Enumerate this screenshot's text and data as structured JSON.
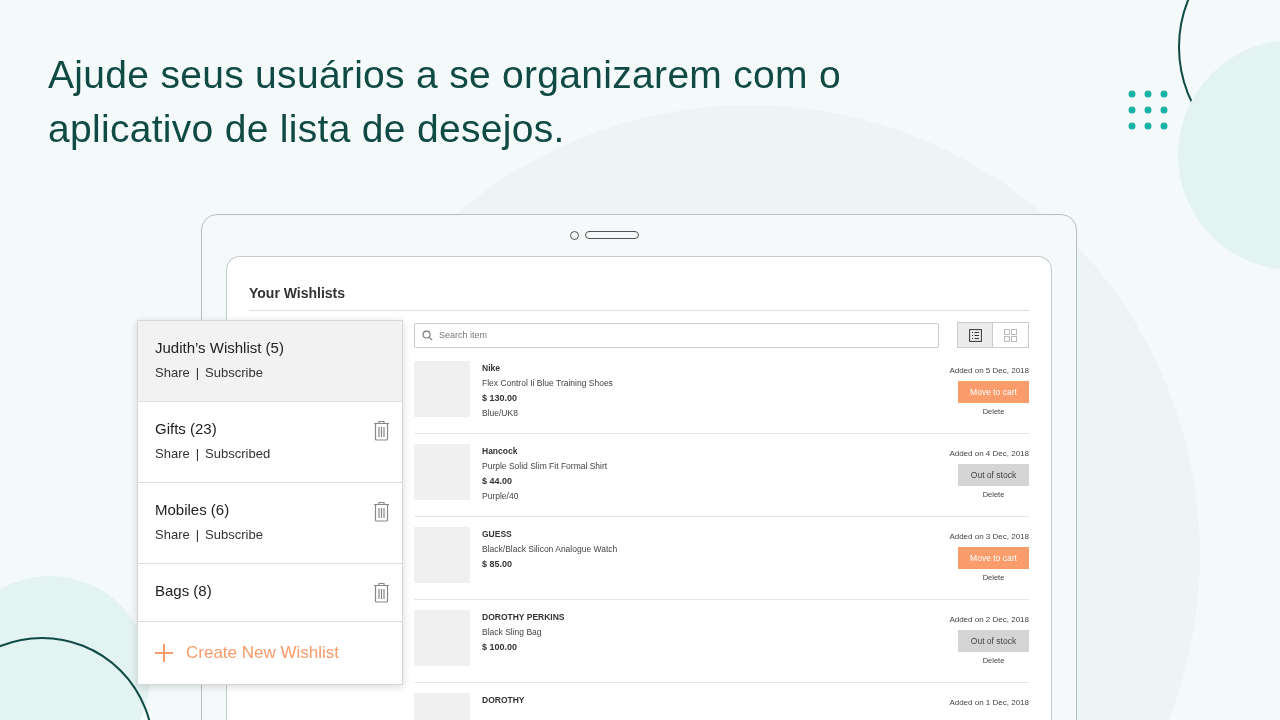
{
  "headline": "Ajude seus usuários a se organizarem com o aplicativo de lista de desejos.",
  "screen": {
    "title": "Your Wishlists",
    "search": {
      "placeholder": "Search item"
    },
    "views": [
      {
        "kind": "list",
        "selected": true
      },
      {
        "kind": "grid",
        "selected": false
      }
    ],
    "products": [
      {
        "brand": "Nike",
        "name": "Flex Control Ii Blue Training Shoes",
        "price": "$ 130.00",
        "variant": "Blue/UK8",
        "added": "Added on 5 Dec, 2018",
        "action": {
          "label": "Move to cart",
          "kind": "cart"
        },
        "delete": "Delete"
      },
      {
        "brand": "Hancock",
        "name": "Purple Solid Slim Fit Formal Shirt",
        "price": "$ 44.00",
        "variant": "Purple/40",
        "added": "Added on 4 Dec, 2018",
        "action": {
          "label": "Out of stock",
          "kind": "oos"
        },
        "delete": "Delete"
      },
      {
        "brand": "GUESS",
        "name": "Black/Black Silicon Analogue Watch",
        "price": "$ 85.00",
        "added": "Added on 3 Dec, 2018",
        "action": {
          "label": "Move to cart",
          "kind": "cart"
        },
        "delete": "Delete"
      },
      {
        "brand": "DOROTHY PERKINS",
        "name": "Black Sling Bag",
        "price": "$ 100.00",
        "added": "Added on 2 Dec, 2018",
        "action": {
          "label": "Out of stock",
          "kind": "oos"
        },
        "delete": "Delete"
      },
      {
        "brand": "DOROTHY",
        "added": "Added on 1 Dec, 2018"
      }
    ]
  },
  "wishlists": [
    {
      "name": "Judith’s Wishlist (5)",
      "selected": true,
      "deletable": false,
      "links": [
        "Share",
        "Subscribe"
      ],
      "separator": "|"
    },
    {
      "name": "Gifts (23)",
      "selected": false,
      "deletable": true,
      "links": [
        "Share",
        "Subscribed"
      ],
      "separator": "|"
    },
    {
      "name": "Mobiles (6)",
      "selected": false,
      "deletable": true,
      "links": [
        "Share",
        "Subscribe"
      ],
      "separator": "|"
    },
    {
      "name": "Bags (8)",
      "selected": false,
      "deletable": true
    }
  ],
  "create_button": {
    "label": "Create New Wishlist"
  }
}
